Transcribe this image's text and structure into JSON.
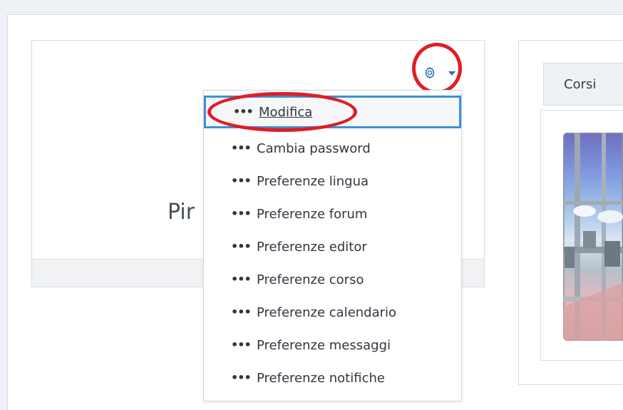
{
  "profile": {
    "name_partial": "Pir",
    "settings_icon": "gear-icon",
    "caret_icon": "caret-down-icon"
  },
  "settings_menu": {
    "items": [
      {
        "label": "Modifica",
        "icon": "dots-icon",
        "active": true
      },
      {
        "label": "Cambia password",
        "icon": "dots-icon"
      },
      {
        "label": "Preferenze lingua",
        "icon": "dots-icon"
      },
      {
        "label": "Preferenze forum",
        "icon": "dots-icon"
      },
      {
        "label": "Preferenze editor",
        "icon": "dots-icon"
      },
      {
        "label": "Preferenze corso",
        "icon": "dots-icon"
      },
      {
        "label": "Preferenze calendario",
        "icon": "dots-icon"
      },
      {
        "label": "Preferenze messaggi",
        "icon": "dots-icon"
      },
      {
        "label": "Preferenze notifiche",
        "icon": "dots-icon"
      }
    ]
  },
  "courses": {
    "tab_label": "Corsi"
  },
  "colors": {
    "annotation_red": "#e01d25",
    "focus_blue": "#3f8fd8",
    "link_blue": "#2b6fb8",
    "text": "#2f3740"
  }
}
